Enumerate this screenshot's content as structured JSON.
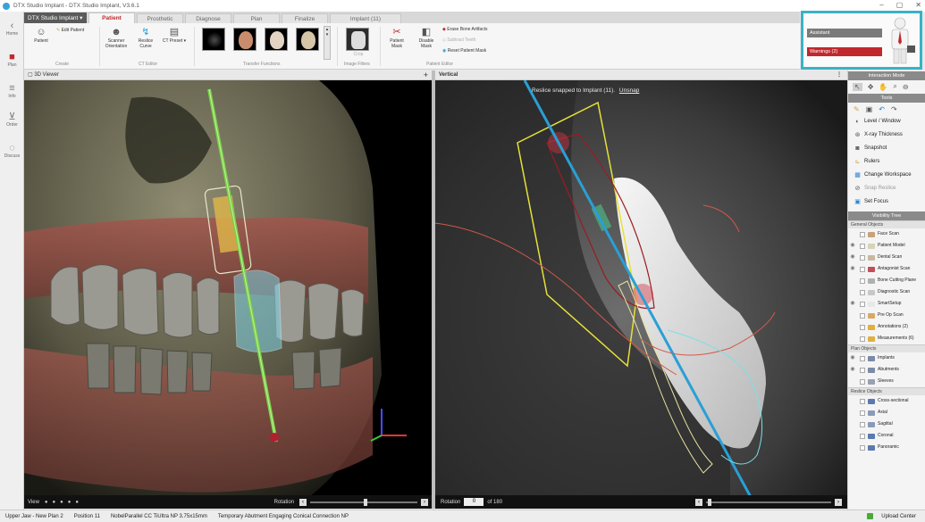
{
  "window": {
    "title": "DTX Studio Implant - DTX Studio Implant, V3.6.1",
    "controls": [
      "–",
      "▢",
      "✕"
    ]
  },
  "product_tab": "DTX Studio Implant",
  "tabs": [
    "Patient",
    "Prosthetic",
    "Diagnose",
    "Plan",
    "Finalize",
    "Implant (11)"
  ],
  "active_tab": "Patient",
  "sidebar": [
    {
      "label": "Home",
      "icon": "back-icon"
    },
    {
      "label": "Plan",
      "icon": "plan-icon"
    },
    {
      "label": "Info",
      "icon": "info-icon"
    },
    {
      "label": "Order",
      "icon": "cart-icon"
    },
    {
      "label": "Discuss",
      "icon": "chat-icon"
    }
  ],
  "ribbon": {
    "patient": "Patient",
    "edit_patient": "Edit Patient",
    "create_group": "Create",
    "scanner_orientation": "Scanner Orientation",
    "reslice_curve": "Reslice Curve",
    "ct_preset": "CT Preset",
    "ct_group": "CT Editor",
    "transfer_group": "Transfer Functions",
    "crop": "Crop",
    "filters_group": "Image Filters",
    "patient_mask": "Patient Mask",
    "disable_mask": "Disable Mask",
    "erase_artifacts": "Erase Bone Artifacts",
    "subtract_teeth": "Subtract Teeth",
    "reset_mask": "Reset Patient Mask",
    "editor_group": "Patient Editor"
  },
  "assistant": {
    "title": "Assistant",
    "warnings": "Warnings (2)"
  },
  "viewer3d": {
    "title": "3D Viewer",
    "view_label": "View",
    "rotation_label": "Rotation"
  },
  "vertical": {
    "title": "Vertical",
    "banner": "Reslice snapped to Implant (11).",
    "unsnap": "Unsnap",
    "rotation_label": "Rotation",
    "rotation_value": "0",
    "rotation_of": "of 180"
  },
  "interaction": {
    "header": "Interaction Mode"
  },
  "tools": {
    "header": "Tools",
    "items": [
      {
        "label": "Level / Window",
        "disabled": false
      },
      {
        "label": "X-ray Thickness",
        "disabled": false
      },
      {
        "label": "Snapshot",
        "disabled": false
      },
      {
        "label": "Rulers",
        "disabled": false
      },
      {
        "label": "Change Workspace",
        "disabled": false
      },
      {
        "label": "Snap Reslice",
        "disabled": true
      },
      {
        "label": "Set Focus",
        "disabled": false
      }
    ]
  },
  "visibility": {
    "header": "Visibility Tree",
    "general_header": "General Objects",
    "general": [
      "Face Scan",
      "Patient Model",
      "Dental Scan",
      "Antagonist Scan",
      "Bone Cutting Plane",
      "Diagnostic Scan",
      "SmartSetup",
      "Pre Op Scan",
      "Annotations (2)",
      "Measurements (6)"
    ],
    "plan_header": "Plan Objects",
    "plan": [
      "Implants",
      "Abutments",
      "Sleeves"
    ],
    "reslice_header": "Reslice Objects",
    "reslice": [
      "Cross-sectional",
      "Axial",
      "Sagittal",
      "Coronal",
      "Panoramic"
    ]
  },
  "status": {
    "jaw": "Upper Jaw - New Plan 2",
    "position": "Position 11",
    "implant": "NobelParallel CC TiUltra NP 3.75x15mm",
    "abutment": "Temporary Abutment Engaging Conical Connection NP",
    "upload": "Upload Center"
  },
  "colors": {
    "accent": "#c0282d",
    "highlight": "#3ab2c6",
    "implant_axis": "#2a9fd6"
  }
}
